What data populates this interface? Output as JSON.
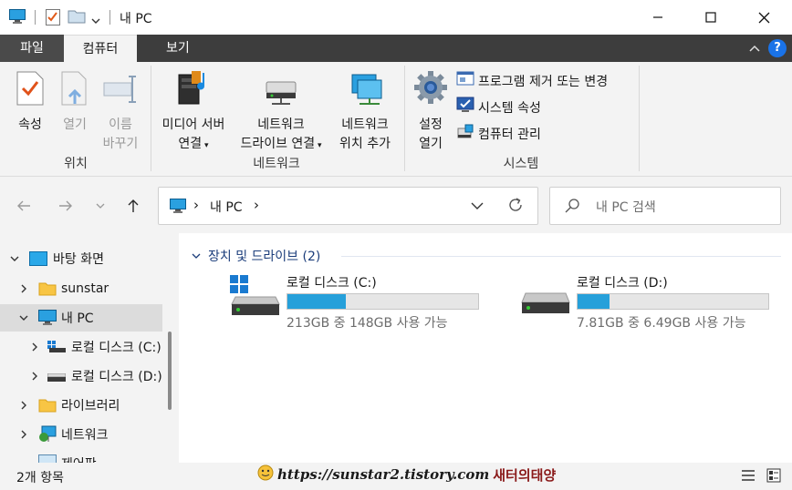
{
  "window": {
    "title": "내 PC"
  },
  "ribbon_tabs": {
    "file": "파일",
    "computer": "컴퓨터",
    "view": "보기",
    "help": "?"
  },
  "ribbon": {
    "location": {
      "properties": "속성",
      "open": "열기",
      "rename_line1": "이름",
      "rename_line2": "바꾸기",
      "group_label": "위치"
    },
    "network": {
      "media_line1": "미디어 서버",
      "media_line2": "연결",
      "map_line1": "네트워크",
      "map_line2": "드라이브 연결",
      "add_line1": "네트워크",
      "add_line2": "위치 추가",
      "group_label": "네트워크"
    },
    "system": {
      "settings_line1": "설정",
      "settings_line2": "열기",
      "uninstall": "프로그램 제거 또는 변경",
      "sys_props": "시스템 속성",
      "manage": "컴퓨터 관리",
      "group_label": "시스템"
    }
  },
  "addressbar": {
    "path_item": "내 PC",
    "separator": "›"
  },
  "search": {
    "placeholder": "내 PC 검색"
  },
  "nav": {
    "items": [
      {
        "label": "바탕 화면",
        "icon": "desktop-folder-icon"
      },
      {
        "label": "sunstar",
        "icon": "folder-icon"
      },
      {
        "label": "내 PC",
        "icon": "monitor-icon"
      },
      {
        "label": "로컬 디스크 (C:)",
        "icon": "drive-c-icon"
      },
      {
        "label": "로컬 디스크 (D:)",
        "icon": "drive-d-icon"
      },
      {
        "label": "라이브러리",
        "icon": "library-folder-icon"
      },
      {
        "label": "네트워크",
        "icon": "network-icon"
      },
      {
        "label": "제어판",
        "icon": "control-panel-icon"
      }
    ]
  },
  "content": {
    "group_title": "장치 및 드라이브 (2)",
    "drives": [
      {
        "name": "로컬 디스크 (C:)",
        "info": "213GB 중 148GB 사용 가능",
        "used_fraction": 0.305
      },
      {
        "name": "로컬 디스크 (D:)",
        "info": "7.81GB 중 6.49GB 사용 가능",
        "used_fraction": 0.169
      }
    ]
  },
  "status": {
    "count": "2개 항목"
  },
  "watermark": {
    "url": "https://sunstar2.tistory.com",
    "name": "새터의태양"
  },
  "colors": {
    "accent": "#26a0da",
    "ribbon_dark": "#3d3d3d",
    "help_blue": "#1a73e8"
  }
}
